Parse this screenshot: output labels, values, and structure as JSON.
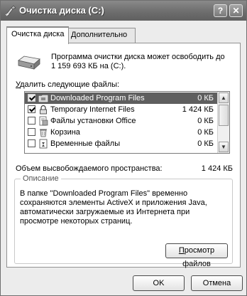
{
  "window": {
    "title": "Очистка диска  (C:)",
    "help_label": "?",
    "close_label": "✕"
  },
  "tabs": [
    {
      "label": "Очистка диска",
      "active": true
    },
    {
      "label": "Дополнительно",
      "active": false
    }
  ],
  "intro_text": "Программа очистки диска может освободить до 1 159 693 КБ на  (C:).",
  "delete_label": {
    "underlined": "У",
    "rest": "далить следующие файлы:"
  },
  "files": [
    {
      "name": "Downloaded Program Files",
      "size": "0 КБ",
      "checked": true,
      "selected": true,
      "icon": "folder-icon"
    },
    {
      "name": "Temporary Internet Files",
      "size": "1 424 КБ",
      "checked": true,
      "selected": false,
      "icon": "lock-icon"
    },
    {
      "name": "Файлы установки Office",
      "size": "0 КБ",
      "checked": false,
      "selected": false,
      "icon": "office-icon"
    },
    {
      "name": "Корзина",
      "size": "0 КБ",
      "checked": false,
      "selected": false,
      "icon": "recycle-bin-icon"
    },
    {
      "name": "Временные файлы",
      "size": "0 КБ",
      "checked": false,
      "selected": false,
      "icon": "temp-files-icon"
    }
  ],
  "space": {
    "label": "Объем высвобождаемого пространства:",
    "value": "1 424 КБ"
  },
  "description": {
    "title": "Описание",
    "text": "В папке \"Downloaded Program Files\" временно сохраняются элементы ActiveX и приложения Java, автоматически загружаемые из Интернета при просмотре некоторых страниц."
  },
  "view_button": {
    "underlined": "П",
    "rest": "росмотр файлов"
  },
  "ok_label": "OK",
  "cancel_label": "Отмена"
}
